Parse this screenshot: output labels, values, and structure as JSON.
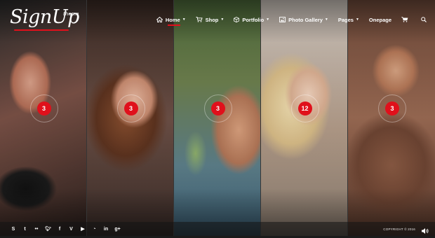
{
  "logo": {
    "text": "SignUp",
    "sub": "theme"
  },
  "nav": {
    "items": [
      {
        "label": "Home",
        "icon": "home-icon",
        "active": true
      },
      {
        "label": "Shop",
        "icon": "cart-icon"
      },
      {
        "label": "Portfolio",
        "icon": "cube-icon"
      },
      {
        "label": "Photo Gallery",
        "icon": "picture-icon"
      },
      {
        "label": "Pages"
      },
      {
        "label": "Onepage"
      }
    ]
  },
  "gallery": {
    "panels": [
      {
        "count": "3"
      },
      {
        "count": "3"
      },
      {
        "count": "3"
      },
      {
        "count": "12"
      },
      {
        "count": "3"
      }
    ]
  },
  "footer": {
    "social": [
      "skype-icon",
      "tumblr-icon",
      "flickr-icon",
      "twitter-icon",
      "facebook-icon",
      "vimeo-icon",
      "youtube-icon",
      "rss-icon",
      "linkedin-icon",
      "google-plus-icon"
    ],
    "copyright": "COPYRIGHT © 2016"
  },
  "colors": {
    "accent": "#e0101b"
  }
}
